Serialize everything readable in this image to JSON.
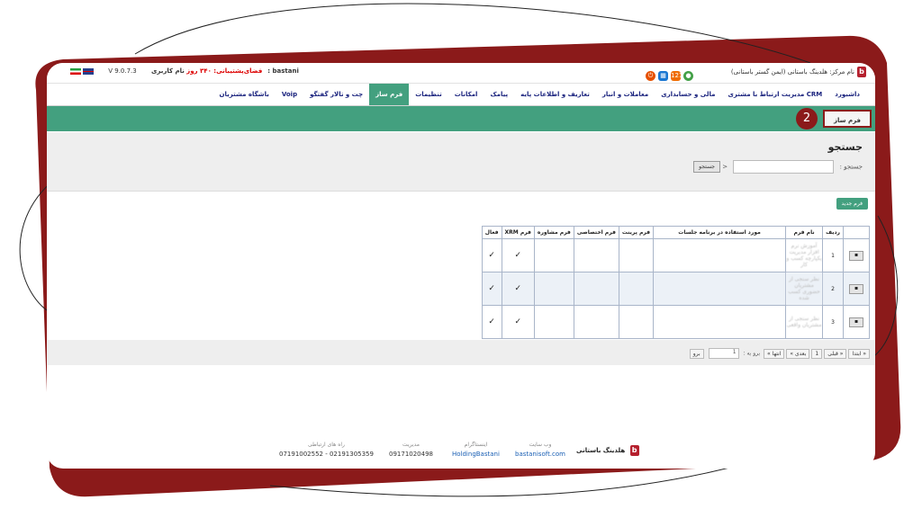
{
  "topbar": {
    "version": "V 9.0.7.3",
    "support_label": "فضای‌پشتیبانی: ۳۴۰ روز",
    "user_label": "نام کاربری: bastani",
    "center_title": "نام مرکز: هلدینگ باستانی (ایمن گستر باستانی)",
    "notification_count": "121"
  },
  "menu": {
    "items": [
      "داشبورد",
      "مدیریت ارتباط با مشتری CRM",
      "مالی و حسابداری",
      "معاملات و انبار",
      "تعاریف و اطلاعات پایه",
      "پیامک",
      "امکانات",
      "تنظیمات",
      "فرم ساز",
      "چت و تالار گفتگو",
      "Voip",
      "باشگاه مشتریان"
    ],
    "active_index": 8
  },
  "toolbar": {
    "form_builder_label": "فرم ساز",
    "step_badge": "2"
  },
  "search": {
    "title": "جستجو",
    "label": "جستجو :",
    "button": "جستجو"
  },
  "new_form_button": "فرم جدید",
  "table": {
    "headers": [
      "ردیف",
      "نام فرم",
      "مورد استفاده در برنامه جلسات",
      "فرم پرینت",
      "فرم اختصاصی",
      "فرم مشاوره",
      "فرم XRM",
      "فعال"
    ],
    "rows": [
      {
        "num": "1",
        "name": "آموزش نرم افزار مدیریت یکپارچه کسب و کار",
        "xrm": "✓",
        "active": "✓"
      },
      {
        "num": "2",
        "name": "نظر سنجی از مشتریان حضوری کسب شده",
        "xrm": "✓",
        "active": "✓"
      },
      {
        "num": "3",
        "name": "نظر سنجی از مشتریان واقعی",
        "xrm": "✓",
        "active": "✓"
      }
    ],
    "row_button": "▪"
  },
  "pager": {
    "first": "« ابتدا",
    "prev": "« قبلی",
    "page": "1",
    "next": "بعدی »",
    "last": "انتها »",
    "goto_label": "برو به :",
    "goto_value": "1",
    "goto_button": "برو"
  },
  "footer": {
    "brand": "هلدینگ باستانی",
    "website_label": "وب سایت",
    "website_value": "bastanisoft.com",
    "instagram_label": "اینستاگرام",
    "instagram_value": "HoldingBastani",
    "management_label": "مدیریت",
    "management_value": "09171020498",
    "contact_label": "راه های ارتباطی",
    "contact_value": "07191002552 - 02191305359"
  },
  "colors": {
    "frame_red": "#8b1a1a",
    "green": "#43a07f",
    "menu_text": "#1a237e"
  }
}
